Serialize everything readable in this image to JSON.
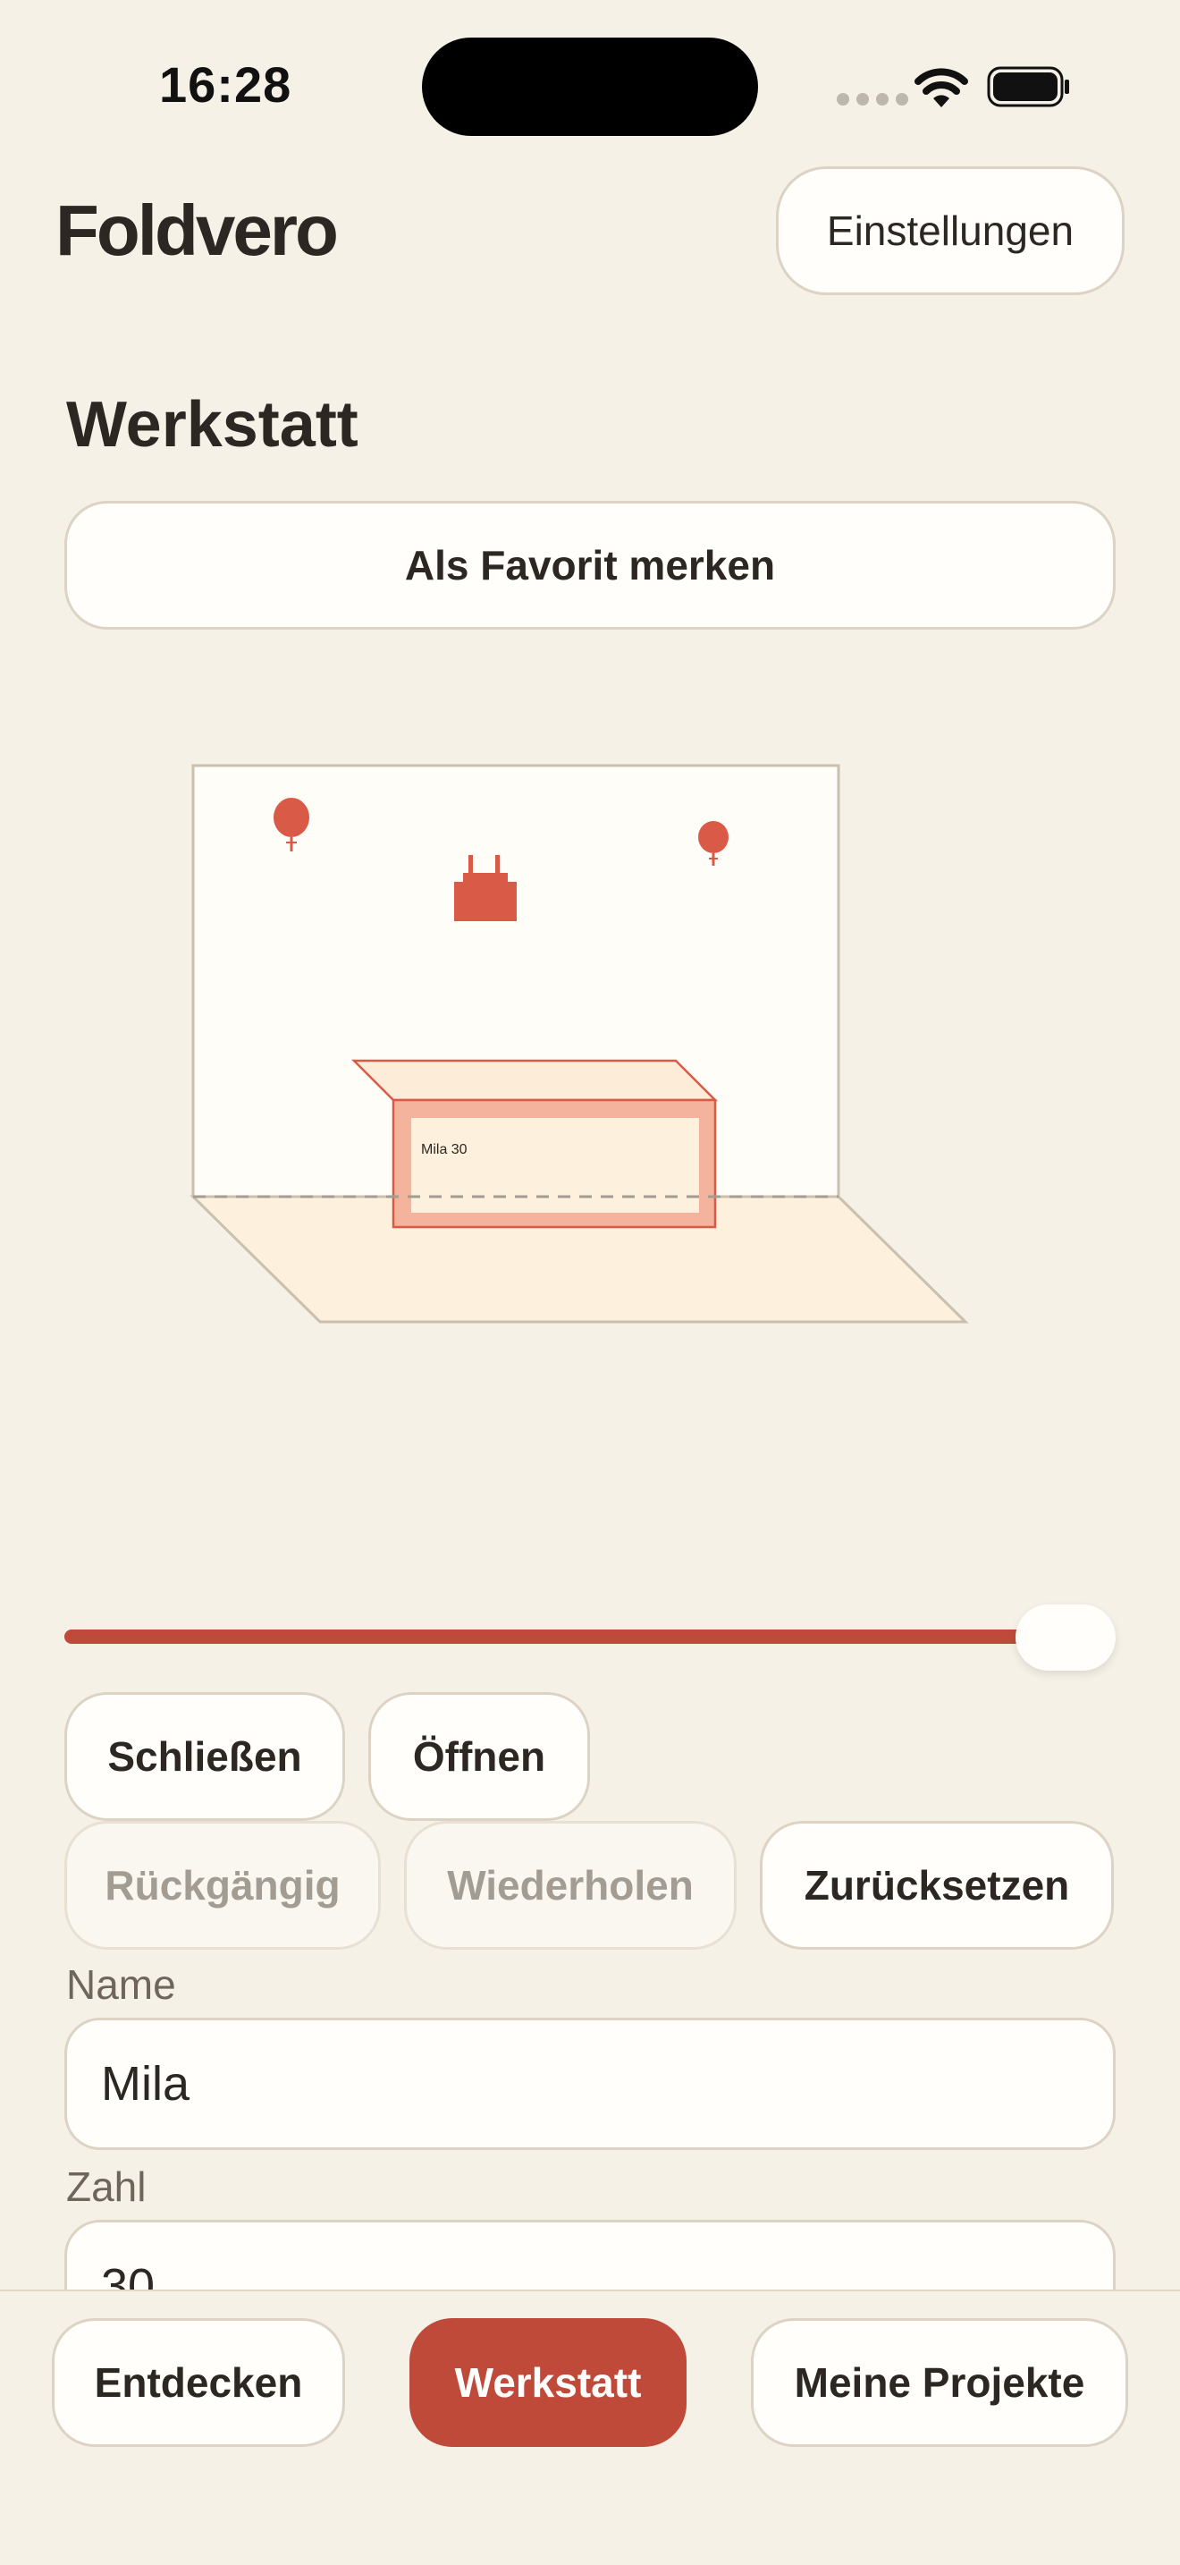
{
  "status_bar": {
    "time": "16:28"
  },
  "header": {
    "logo": "Foldvero",
    "settings_label": "Einstellungen"
  },
  "workshop": {
    "title": "Werkstatt",
    "favorite_label": "Als Favorit merken",
    "card_label": "Mila 30"
  },
  "fold_slider": {
    "value": 1.0
  },
  "controls": {
    "close_label": "Schließen",
    "open_label": "Öffnen",
    "undo_label": "Rückgängig",
    "redo_label": "Wiederholen",
    "reset_label": "Zurücksetzen"
  },
  "form": {
    "name_label": "Name",
    "name_value": "Mila",
    "number_label": "Zahl",
    "number_value": "30"
  },
  "bottom_nav": {
    "items": [
      {
        "label": "Entdecken",
        "active": false
      },
      {
        "label": "Werkstatt",
        "active": true
      },
      {
        "label": "Meine Projekte",
        "active": false
      }
    ]
  },
  "colors": {
    "accent": "#bf4a3a",
    "background": "#f6f1e7",
    "surface": "#fffefb"
  }
}
